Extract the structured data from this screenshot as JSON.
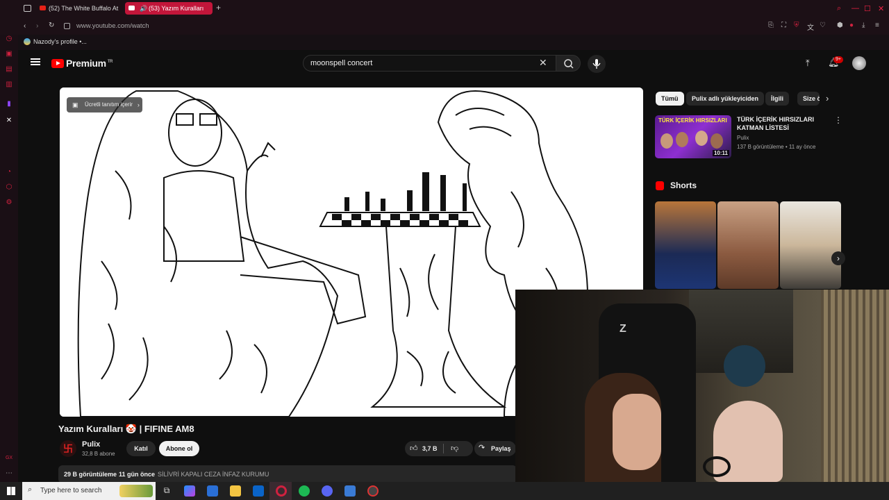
{
  "browser": {
    "tabs": [
      {
        "label": "(52) The White Buffalo At"
      },
      {
        "label": "(53) Yazım Kuralları"
      }
    ],
    "new_tab_label": "+",
    "url": "www.youtube.com/watch",
    "bookmark": "Nazody's profile •..."
  },
  "youtube": {
    "logo_text": "Premium",
    "logo_region": "TR",
    "search_value": "moonspell concert",
    "notification_count": "9+",
    "promo_label": "Ücretli tanıtım içerir",
    "video_title": "Yazım Kuralları 🤡 | FIFINE AM8",
    "channel_name": "Pulix",
    "subscriber_count": "32,8 B abone",
    "join_label": "Katıl",
    "subscribe_label": "Abone ol",
    "like_count": "3,7 B",
    "share_label": "Paylaş",
    "views": "29 B görüntüleme",
    "date": "11 gün önce",
    "description_tag": "SİLİVRİ KAPALI CEZA İNFAZ KURUMU",
    "chips": [
      "Tümü",
      "Pulix adlı yükleyiciden",
      "İlgili",
      "Size ö"
    ],
    "rec_video": {
      "thumb_label": "TÜRK İÇERİK HIRSIZLARI",
      "duration": "10:11",
      "title": "TÜRK İÇERİK HIRSIZLARI KATMAN LİSTESİ",
      "channel": "Pulix",
      "meta": "137 B görüntüleme • 11 ay önce"
    },
    "shorts_label": "Shorts"
  },
  "taskbar": {
    "search_placeholder": "Type here to search"
  },
  "colors": {
    "accent": "#ff0000",
    "opera_red": "#d0213f",
    "yt_bg": "#0f0f0f"
  }
}
